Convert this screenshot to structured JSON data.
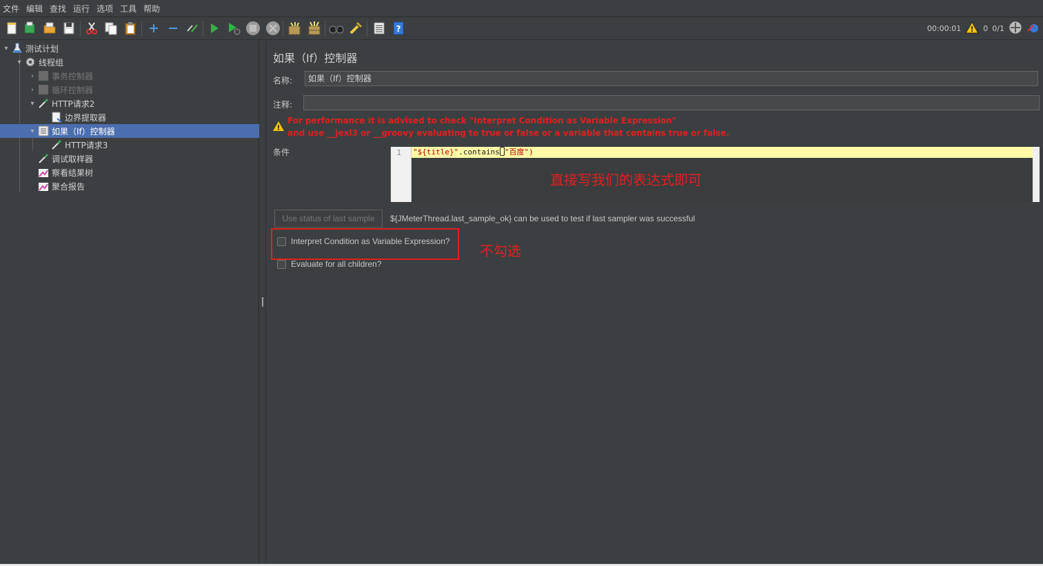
{
  "menubar": {
    "items": [
      "文件",
      "编辑",
      "查找",
      "运行",
      "选项",
      "工具",
      "帮助"
    ]
  },
  "toolbar": {
    "buttons": [
      "new-icon",
      "templates-icon",
      "open-icon",
      "save-icon",
      "cut-icon",
      "copy-icon",
      "paste-icon",
      "expand-icon",
      "collapse-icon",
      "toggle-icon",
      "start-icon",
      "start-no-pause-icon",
      "stop-icon",
      "shutdown-icon",
      "clear-icon",
      "clear-all-icon",
      "search-icon",
      "reset-search-icon",
      "function-helper-icon",
      "help-icon"
    ],
    "elapsed": "00:00:01",
    "warning_count": "0",
    "threads": "0/1"
  },
  "tree": {
    "items": [
      {
        "label": "测试计划",
        "icon": "flask-icon"
      },
      {
        "label": "线程组",
        "icon": "gear-icon"
      },
      {
        "label": "事务控制器",
        "icon": "controller-icon"
      },
      {
        "label": "循环控制器",
        "icon": "controller-icon"
      },
      {
        "label": "HTTP请求2",
        "icon": "pipette-icon"
      },
      {
        "label": "边界提取器",
        "icon": "extractor-icon"
      },
      {
        "label": "如果（If）控制器",
        "icon": "controller-icon"
      },
      {
        "label": "HTTP请求3",
        "icon": "pipette-icon"
      },
      {
        "label": "调试取样器",
        "icon": "pipette-icon"
      },
      {
        "label": "察看结果树",
        "icon": "listener-icon"
      },
      {
        "label": "聚合报告",
        "icon": "listener-icon"
      }
    ]
  },
  "panel": {
    "title": "如果（If）控制器",
    "name_label": "名称:",
    "name_value": "如果（If）控制器",
    "comment_label": "注释:",
    "comment_value": "",
    "warning_line1": "For performance it is advised to check \"Interpret Condition as Variable Expression\"",
    "warning_line2": "and use __jexl3 or __groovy evaluating to true or false or a variable that contains true or false.",
    "condition_label": "条件",
    "line_number": "1",
    "code_part1": "\"${title}\"",
    "code_part2": ".contains",
    "code_part3": "\"百度\")",
    "use_status_button": "Use status of last sample",
    "status_hint": "${JMeterThread.last_sample_ok} can be used to test if last sampler was successful",
    "interpret_checkbox": "Interpret Condition as Variable Expression?",
    "evaluate_checkbox": "Evaluate for all children?"
  },
  "annotations": {
    "expression_note": "直接写我们的表达式即可",
    "uncheck_note": "不勾选"
  },
  "colors": {
    "accent_red": "#e02020",
    "selection": "#4b6eaf",
    "background": "#3c3f41"
  }
}
